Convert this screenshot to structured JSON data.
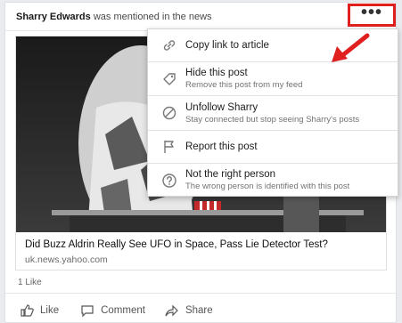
{
  "post": {
    "author": "Sharry Edwards",
    "context": "was mentioned in the news",
    "more_label": "•••"
  },
  "article": {
    "title": "Did Buzz Aldrin Really See UFO in Space, Pass Lie Detector Test?",
    "source": "uk.news.yahoo.com"
  },
  "reactions": {
    "likes": "1 Like"
  },
  "actions": {
    "like": "Like",
    "comment": "Comment",
    "share": "Share"
  },
  "menu": {
    "items": [
      {
        "icon": "link-icon",
        "label": "Copy link to article",
        "sub": ""
      },
      {
        "icon": "tag-icon",
        "label": "Hide this post",
        "sub": "Remove this post from my feed"
      },
      {
        "icon": "block-icon",
        "label": "Unfollow Sharry",
        "sub": "Stay connected but stop seeing Sharry's posts"
      },
      {
        "icon": "flag-icon",
        "label": "Report this post",
        "sub": ""
      },
      {
        "icon": "question-icon",
        "label": "Not the right person",
        "sub": "The wrong person is identified with this post"
      }
    ]
  },
  "colors": {
    "highlight": "#e0201f",
    "text": "#1d1d1d",
    "muted": "#737373"
  }
}
